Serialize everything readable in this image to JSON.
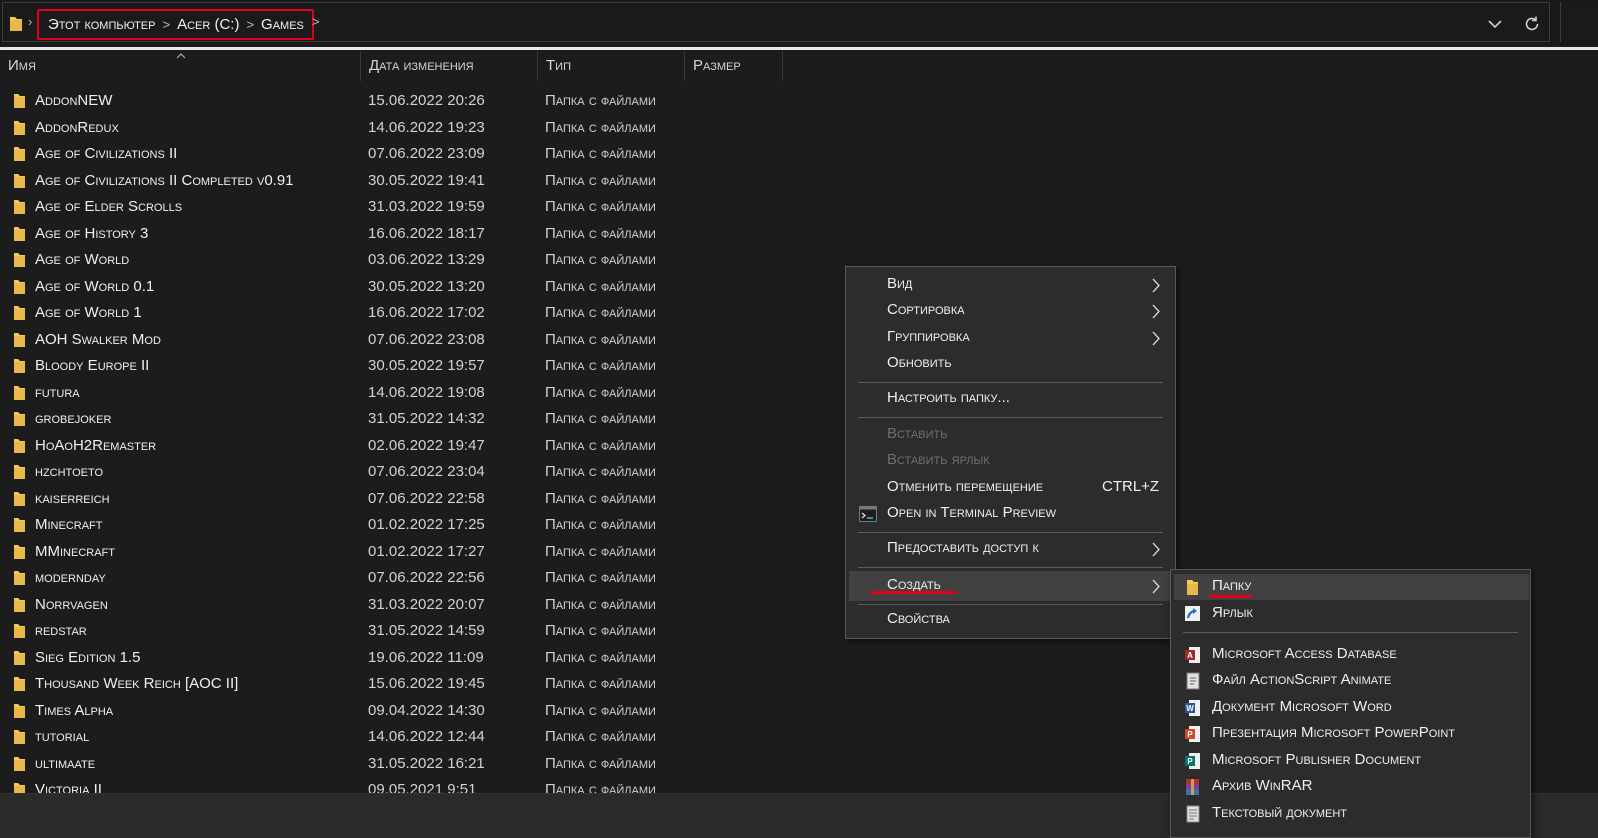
{
  "address_bar": {
    "breadcrumbs": [
      "Этот компьютер",
      "Acer (C:)",
      "Games"
    ],
    "separator": ">",
    "highlight_color": "#e3001b"
  },
  "columns": {
    "name": "Имя",
    "date": "Дата изменения",
    "type": "Тип",
    "size": "Размер"
  },
  "files": [
    {
      "name": "AddonNEW",
      "date": "15.06.2022 20:26",
      "type": "Папка с файлами"
    },
    {
      "name": "AddonRedux",
      "date": "14.06.2022 19:23",
      "type": "Папка с файлами"
    },
    {
      "name": "Age of Civilizations II",
      "date": "07.06.2022 23:09",
      "type": "Папка с файлами"
    },
    {
      "name": "Age of Civilizations II Completed v0.91",
      "date": "30.05.2022 19:41",
      "type": "Папка с файлами"
    },
    {
      "name": "Age of Elder Scrolls",
      "date": "31.03.2022 19:59",
      "type": "Папка с файлами"
    },
    {
      "name": "Age of History 3",
      "date": "16.06.2022 18:17",
      "type": "Папка с файлами"
    },
    {
      "name": "Age of World",
      "date": "03.06.2022 13:29",
      "type": "Папка с файлами"
    },
    {
      "name": "Age of World 0.1",
      "date": "30.05.2022 13:20",
      "type": "Папка с файлами"
    },
    {
      "name": "Age of World 1",
      "date": "16.06.2022 17:02",
      "type": "Папка с файлами"
    },
    {
      "name": "AOH Swalker Mod",
      "date": "07.06.2022 23:08",
      "type": "Папка с файлами"
    },
    {
      "name": "Bloody Europe II",
      "date": "30.05.2022 19:57",
      "type": "Папка с файлами"
    },
    {
      "name": "futura",
      "date": "14.06.2022 19:08",
      "type": "Папка с файлами"
    },
    {
      "name": "grobejoker",
      "date": "31.05.2022 14:32",
      "type": "Папка с файлами"
    },
    {
      "name": "HoAoH2Remaster",
      "date": "02.06.2022 19:47",
      "type": "Папка с файлами"
    },
    {
      "name": "hzchtoeto",
      "date": "07.06.2022 23:04",
      "type": "Папка с файлами"
    },
    {
      "name": "kaiserreich",
      "date": "07.06.2022 22:58",
      "type": "Папка с файлами"
    },
    {
      "name": "Minecraft",
      "date": "01.02.2022 17:25",
      "type": "Папка с файлами"
    },
    {
      "name": "MMinecraft",
      "date": "01.02.2022 17:27",
      "type": "Папка с файлами"
    },
    {
      "name": "modernday",
      "date": "07.06.2022 22:56",
      "type": "Папка с файлами"
    },
    {
      "name": "Norrvagen",
      "date": "31.03.2022 20:07",
      "type": "Папка с файлами"
    },
    {
      "name": "redstar",
      "date": "31.05.2022 14:59",
      "type": "Папка с файлами"
    },
    {
      "name": "Sieg Edition 1.5",
      "date": "19.06.2022 11:09",
      "type": "Папка с файлами"
    },
    {
      "name": "Thousand Week Reich [AOC II]",
      "date": "15.06.2022 19:45",
      "type": "Папка с файлами"
    },
    {
      "name": "Times Alpha",
      "date": "09.04.2022 14:30",
      "type": "Папка с файлами"
    },
    {
      "name": "tutorial",
      "date": "14.06.2022 12:44",
      "type": "Папка с файлами"
    },
    {
      "name": "ultimaate",
      "date": "31.05.2022 16:21",
      "type": "Папка с файлами"
    },
    {
      "name": "Victoria II",
      "date": "09.05.2021 9:51",
      "type": "Папка с файлами"
    }
  ],
  "context_menu": {
    "view": "Вид",
    "sort": "Сортировка",
    "group": "Группировка",
    "refresh": "Обновить",
    "customize": "Настроить папку...",
    "paste": "Вставить",
    "paste_shortcut": "Вставить ярлык",
    "undo_move": "Отменить перемещение",
    "undo_shortcut_key": "CTRL+Z",
    "terminal": "Open in Terminal Preview",
    "give_access": "Предоставить доступ к",
    "create": "Создать",
    "properties": "Свойства"
  },
  "create_submenu": {
    "folder": "Папку",
    "shortcut": "Ярлык",
    "items": [
      {
        "label": "Microsoft Access Database",
        "icon": "access-icon",
        "color": "#a4262c"
      },
      {
        "label": "Файл ActionScript Animate",
        "icon": "actionscript-file-icon",
        "color": "#e0e0e0"
      },
      {
        "label": "Документ Microsoft Word",
        "icon": "word-icon",
        "color": "#2b579a"
      },
      {
        "label": "Презентация Microsoft PowerPoint",
        "icon": "powerpoint-icon",
        "color": "#d24726"
      },
      {
        "label": "Microsoft Publisher Document",
        "icon": "publisher-icon",
        "color": "#077568"
      },
      {
        "label": "Архив WinRAR",
        "icon": "winrar-icon",
        "color": "#8a3a8f"
      },
      {
        "label": "Текстовый документ",
        "icon": "text-document-icon",
        "color": "#e0e0e0"
      }
    ]
  },
  "colors": {
    "background": "#1c1c1c",
    "folder": "#f5c85c",
    "menu_bg": "#2c2c2c",
    "menu_highlight": "#414141",
    "annotation_red": "#e3001b"
  }
}
